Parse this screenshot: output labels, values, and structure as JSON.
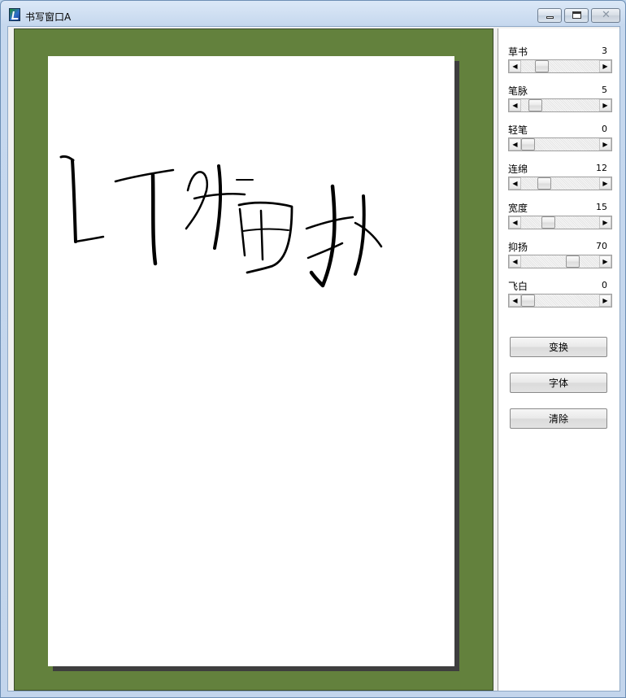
{
  "window": {
    "title": "书写窗口A",
    "controls": {
      "minimize": "minimize",
      "maximize": "maximize",
      "close": "✕"
    }
  },
  "canvas": {
    "background_color": "#63813d",
    "paper_color": "#ffffff",
    "ink_color": "#000000"
  },
  "params": [
    {
      "label": "草书",
      "value": "3",
      "level": 0.22
    },
    {
      "label": "笔脉",
      "value": "5",
      "level": 0.12
    },
    {
      "label": "轻笔",
      "value": "0",
      "level": 0.0
    },
    {
      "label": "连绵",
      "value": "12",
      "level": 0.25
    },
    {
      "label": "宽度",
      "value": "15",
      "level": 0.32
    },
    {
      "label": "抑扬",
      "value": "70",
      "level": 0.7
    },
    {
      "label": "飞白",
      "value": "0",
      "level": 0.0
    }
  ],
  "buttons": {
    "transform": "变换",
    "font": "字体",
    "clear": "清除"
  },
  "icons": {
    "app": "calligraphy-app-icon",
    "scroll_left": "◀",
    "scroll_right": "▶"
  }
}
